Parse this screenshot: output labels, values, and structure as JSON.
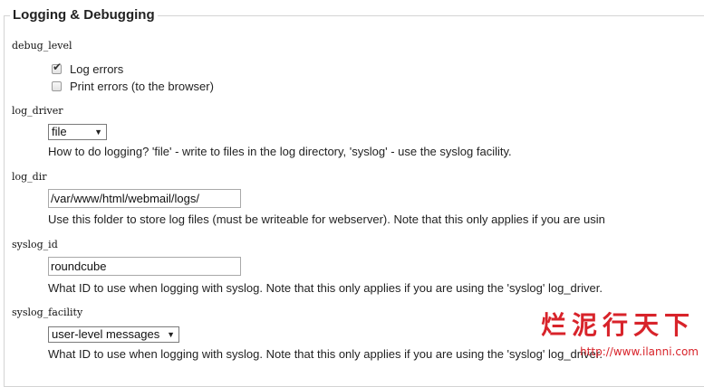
{
  "section": {
    "legend": "Logging & Debugging"
  },
  "debug_level": {
    "key": "debug_level",
    "options": [
      {
        "label": "Log errors",
        "checked": true
      },
      {
        "label": "Print errors (to the browser)",
        "checked": false
      }
    ]
  },
  "log_driver": {
    "key": "log_driver",
    "selected": "file",
    "description": "How to do logging? 'file' - write to files in the log directory, 'syslog' - use the syslog facility."
  },
  "log_dir": {
    "key": "log_dir",
    "value": "/var/www/html/webmail/logs/",
    "description": "Use this folder to store log files (must be writeable for webserver). Note that this only applies if you are usin"
  },
  "syslog_id": {
    "key": "syslog_id",
    "value": "roundcube",
    "description": "What ID to use when logging with syslog. Note that this only applies if you are using the 'syslog' log_driver."
  },
  "syslog_facility": {
    "key": "syslog_facility",
    "selected": "user-level messages",
    "description": "What ID to use when logging with syslog. Note that this only applies if you are using the 'syslog' log_driver."
  },
  "watermark": {
    "text": "烂泥行天下",
    "url": "http://www.ilanni.com"
  },
  "colors": {
    "border": "#d4d4d4",
    "text": "#222222",
    "watermark": "#d8232a"
  }
}
